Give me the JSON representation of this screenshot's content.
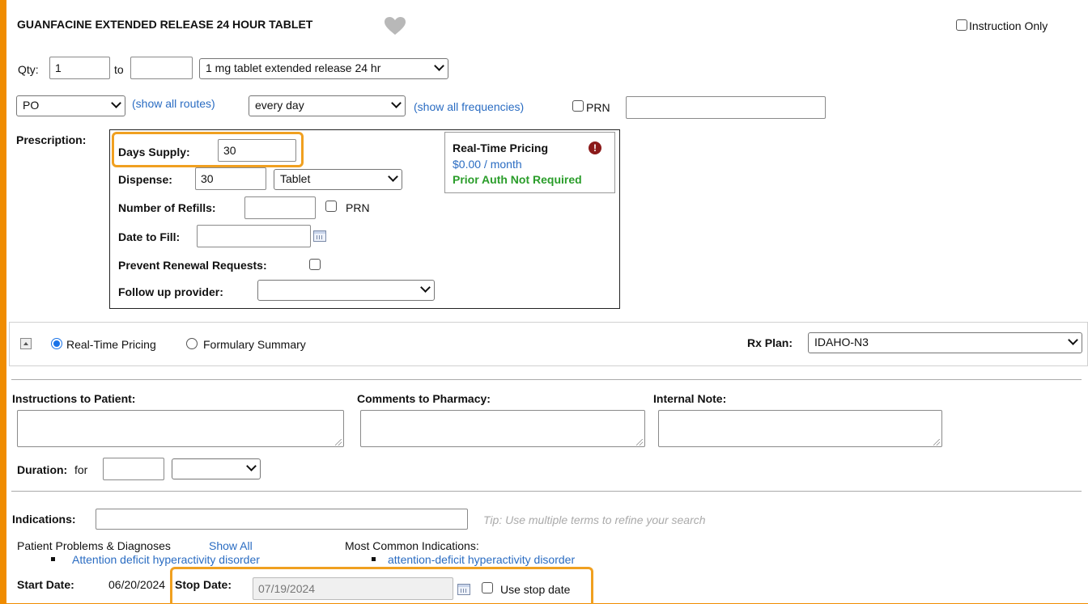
{
  "header": {
    "title": "GUANFACINE EXTENDED RELEASE 24 HOUR TABLET",
    "instruction_only_label": "Instruction Only"
  },
  "qty": {
    "label": "Qty:",
    "value": "1",
    "to_label": "to",
    "to_value": "",
    "strength": "1 mg tablet extended release 24 hr"
  },
  "route": {
    "value": "PO",
    "show_all": "(show all routes)"
  },
  "frequency": {
    "value": "every day",
    "show_all": "(show all frequencies)",
    "prn_label": "PRN",
    "prn_value": ""
  },
  "prescription": {
    "label": "Prescription:",
    "days_supply_label": "Days Supply:",
    "days_supply_value": "30",
    "dispense_label": "Dispense:",
    "dispense_value": "30",
    "dispense_unit": "Tablet",
    "refills_label": "Number of Refills:",
    "refills_value": "",
    "refills_prn": "PRN",
    "date_fill_label": "Date to Fill:",
    "date_fill_value": "",
    "prevent_renewal_label": "Prevent Renewal Requests:",
    "follow_up_label": "Follow up provider:",
    "follow_up_value": ""
  },
  "pricing": {
    "title": "Real-Time Pricing",
    "price": "$0.00 / month",
    "auth": "Prior Auth Not Required"
  },
  "pricing_toggle": {
    "realtime_label": "Real-Time Pricing",
    "formulary_label": "Formulary Summary",
    "rx_plan_label": "Rx Plan:",
    "rx_plan_value": "IDAHO-N3"
  },
  "notes": {
    "patient_label": "Instructions to Patient:",
    "pharmacy_label": "Comments to Pharmacy:",
    "internal_label": "Internal Note:"
  },
  "duration": {
    "label": "Duration:",
    "for_label": "for",
    "value": "",
    "unit": ""
  },
  "indications": {
    "label": "Indications:",
    "value": "",
    "tip": "Tip: Use multiple terms to refine your search"
  },
  "problems": {
    "heading": "Patient Problems & Diagnoses",
    "show_all": "Show All",
    "item": "Attention deficit hyperactivity disorder"
  },
  "common": {
    "heading": "Most Common Indications:",
    "item": "attention-deficit hyperactivity disorder"
  },
  "dates": {
    "start_label": "Start Date:",
    "start_value": "06/20/2024",
    "stop_label": "Stop Date:",
    "stop_value": "07/19/2024",
    "use_stop_label": "Use stop date"
  },
  "colors": {
    "highlight": "#f0a020",
    "link": "#2a6cc2",
    "auth_green": "#2a9d2a",
    "alert_red": "#8b1a1a"
  }
}
